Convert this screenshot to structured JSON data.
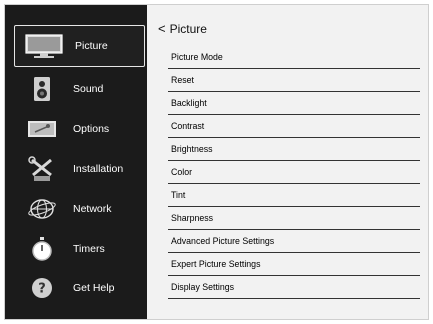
{
  "sidebar": {
    "items": [
      {
        "label": "Picture",
        "icon": "tv-icon",
        "selected": true
      },
      {
        "label": "Sound",
        "icon": "speaker-icon",
        "selected": false
      },
      {
        "label": "Options",
        "icon": "options-icon",
        "selected": false
      },
      {
        "label": "Installation",
        "icon": "tools-icon",
        "selected": false
      },
      {
        "label": "Network",
        "icon": "globe-icon",
        "selected": false
      },
      {
        "label": "Timers",
        "icon": "stopwatch-icon",
        "selected": false
      },
      {
        "label": "Get Help",
        "icon": "help-icon",
        "selected": false
      }
    ]
  },
  "main": {
    "back_chevron": "<",
    "title": "Picture",
    "menu": [
      "Picture Mode",
      "Reset",
      "Backlight",
      "Contrast",
      "Brightness",
      "Color",
      "Tint",
      "Sharpness",
      "Advanced Picture Settings",
      "Expert Picture Settings",
      "Display Settings"
    ]
  },
  "colors": {
    "sidebar_bg": "#1b1b1b",
    "panel_bg": "#f2f2f2",
    "text_dark": "#000000",
    "text_light": "#ffffff"
  }
}
